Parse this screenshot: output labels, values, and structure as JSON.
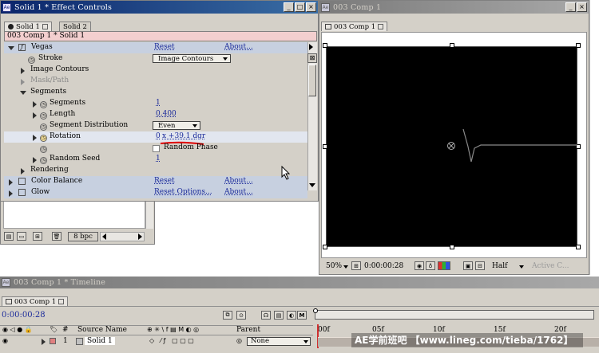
{
  "effect_controls": {
    "title": "Solid 1 * Effect Controls",
    "tabs": [
      "Solid 1",
      "Solid 2"
    ],
    "header": "003 Comp 1 * Solid 1",
    "rows": [
      {
        "label": "Vegas",
        "reset": "Reset",
        "about": "About..."
      },
      {
        "label": "Stroke",
        "value": "Image Contours"
      },
      {
        "label": "Image Contours"
      },
      {
        "label": "Mask/Path"
      },
      {
        "label": "Segments"
      },
      {
        "label": "Segments",
        "value": "1"
      },
      {
        "label": "Length",
        "value": "0.400"
      },
      {
        "label": "Segment Distribution",
        "value": "Even"
      },
      {
        "label": "Rotation",
        "value_prefix": "0",
        "value": "x +39.1 dgr"
      },
      {
        "label": "",
        "value": "Random Phase"
      },
      {
        "label": "Random Seed",
        "value": "1"
      },
      {
        "label": "Rendering"
      },
      {
        "label": "Color Balance",
        "reset": "Reset",
        "about": "About..."
      },
      {
        "label": "Glow",
        "reset": "Reset Options...",
        "about": "About..."
      }
    ]
  },
  "project_panel": {
    "bpc": "8 bpc"
  },
  "comp_viewer": {
    "title": "003 Comp 1",
    "tab": "003 Comp 1",
    "zoom": "50%",
    "timecode": "0:00:00:28",
    "resolution": "Half",
    "camera": "Active C..."
  },
  "timeline": {
    "title": "003 Comp 1 * Timeline",
    "tab": "003 Comp 1",
    "timecode": "0:00:00:28",
    "columns": {
      "num": "#",
      "source": "Source Name",
      "switches": "⊕ ✳ \\ f ▤ M ◐ ◎",
      "parent": "Parent"
    },
    "layer": {
      "num": "1",
      "name": "Solid 1",
      "parent": "None"
    },
    "ruler": [
      "00f",
      "05f",
      "10f",
      "15f",
      "20f"
    ]
  },
  "watermark": "AE学前班吧  【www.lineg.com/tieba/1762】",
  "colors": {
    "title_active": "#0a246a",
    "title_inactive": "#7a7a7a",
    "panel_bg": "#d4d0c8",
    "header_pink": "#f3cfcf",
    "timecode_blue": "#1a2a9a",
    "link_blue": "#1a2a9a",
    "underline_red": "#e00000",
    "watermark_text": "#ffffff"
  }
}
